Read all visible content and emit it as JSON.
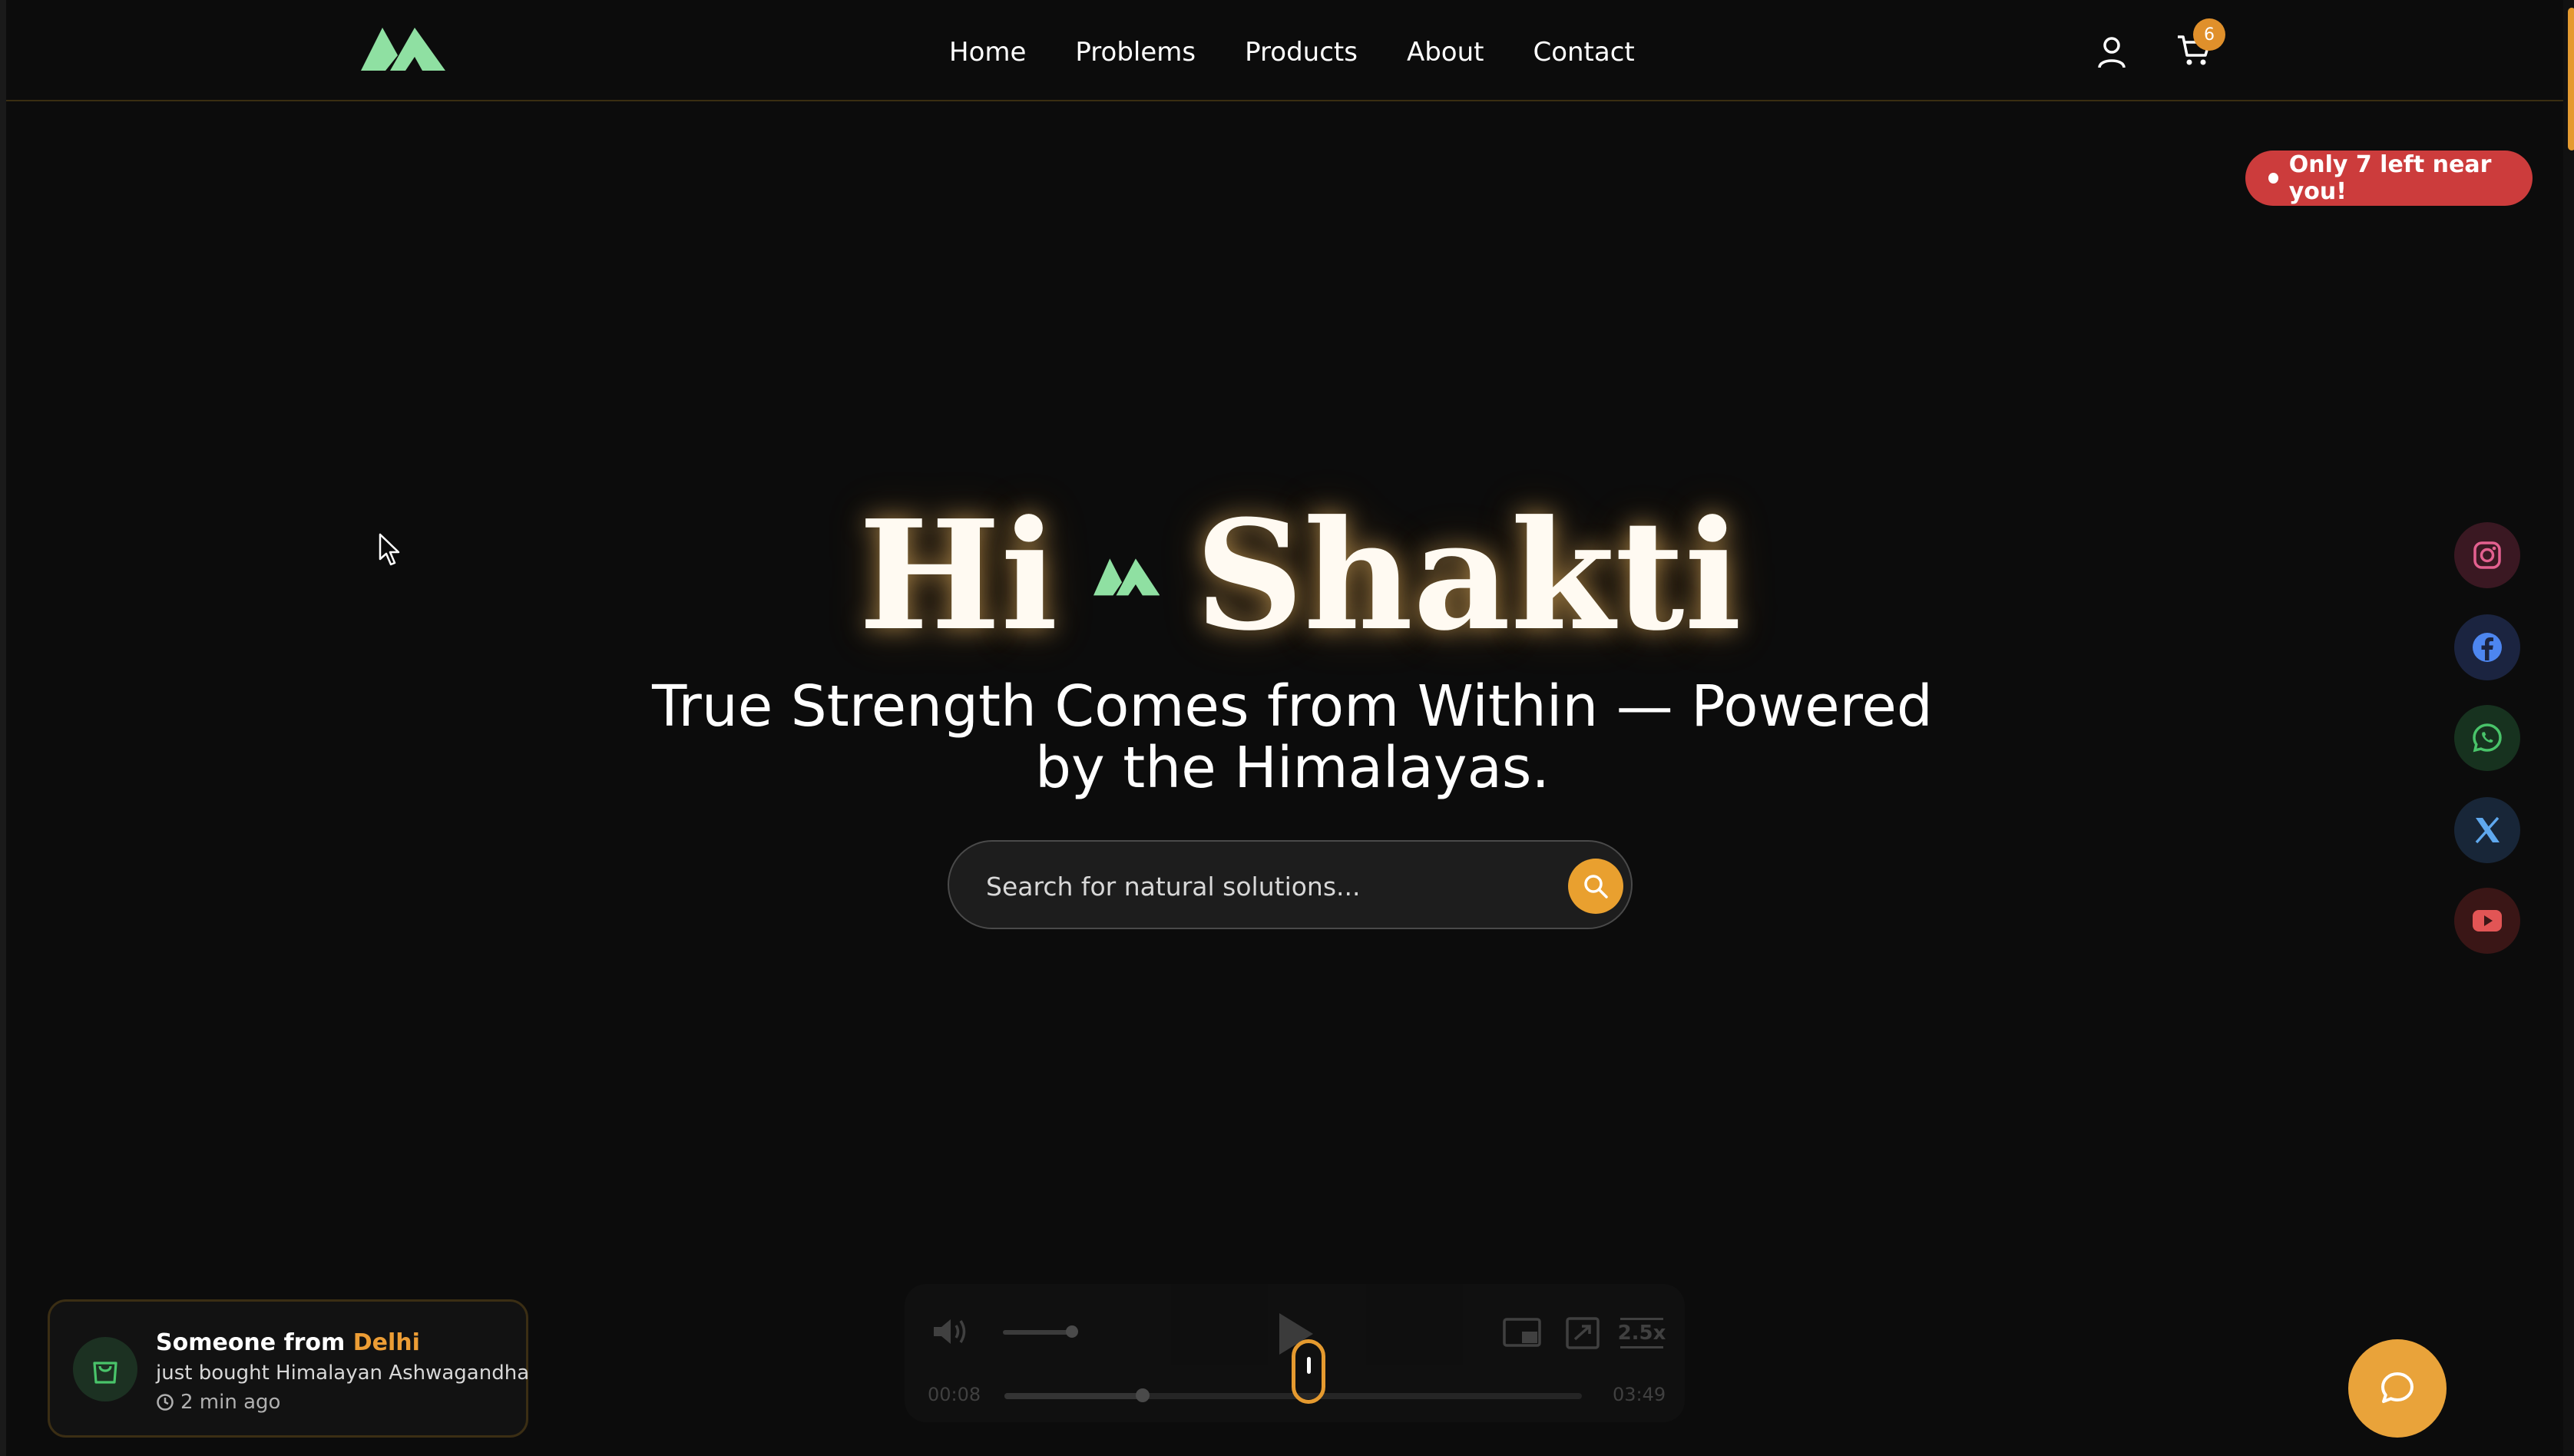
{
  "brand": {
    "logo_icon": "mountain-logo-icon",
    "logo_color": "#8fe0a2"
  },
  "nav": {
    "links": [
      "Home",
      "Problems",
      "Products",
      "About",
      "Contact"
    ],
    "cart_count": "6"
  },
  "stock_alert": "Only 7 left near you!",
  "hero": {
    "greeting": "Hi",
    "name": "Shakti",
    "subtitle": "True Strength Comes from Within — Powered by the Himalayas."
  },
  "search": {
    "placeholder": "Search for natural solutions..."
  },
  "social": [
    "instagram-icon",
    "facebook-icon",
    "whatsapp-icon",
    "x-icon",
    "youtube-icon"
  ],
  "video": {
    "current_time": "00:08",
    "duration": "03:49",
    "speed": "2.5x",
    "progress_fraction": 0.24
  },
  "purchase_toast": {
    "prefix": "Someone from",
    "city": "Delhi",
    "message": "just bought Himalayan Ashwagandha",
    "time_ago": "2 min ago"
  },
  "colors": {
    "accent": "#e9a02f",
    "alert": "#cc3c3c",
    "logo_green": "#8fe0a2"
  }
}
